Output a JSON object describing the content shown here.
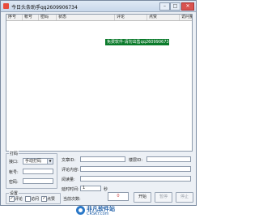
{
  "window": {
    "title": "今日头条助手qq2609906734",
    "minimize": "–",
    "maximize": "□",
    "close": "✕"
  },
  "table": {
    "columns": [
      "序号",
      "帐号",
      "密码",
      "状态",
      "评论",
      "点赞",
      "访问量"
    ]
  },
  "banner": "免费软件·请勿出售qq2609906734",
  "dagong": {
    "legend": "打码",
    "interface_label": "接口:",
    "interface_value": "手动打码",
    "account_label": "帐号:",
    "password_label": "密码:"
  },
  "article": {
    "article_id_label": "文章ID:",
    "topic_id_label": "楼层ID:",
    "comment_label": "评论内容:",
    "read_label": "阅读量:",
    "interval_label": "延时时间:",
    "interval_value": "1",
    "interval_unit": "秒"
  },
  "settings": {
    "legend": "设置",
    "option_1": "评论",
    "option_2": "访问",
    "option_3": "点赞",
    "counter_label": "当前次数:",
    "counter_value": "0",
    "start": "开始",
    "pause": "暂停",
    "stop": "停止"
  },
  "watermark": {
    "brand": "非凡软件站",
    "domain": "CRSKY.com"
  }
}
